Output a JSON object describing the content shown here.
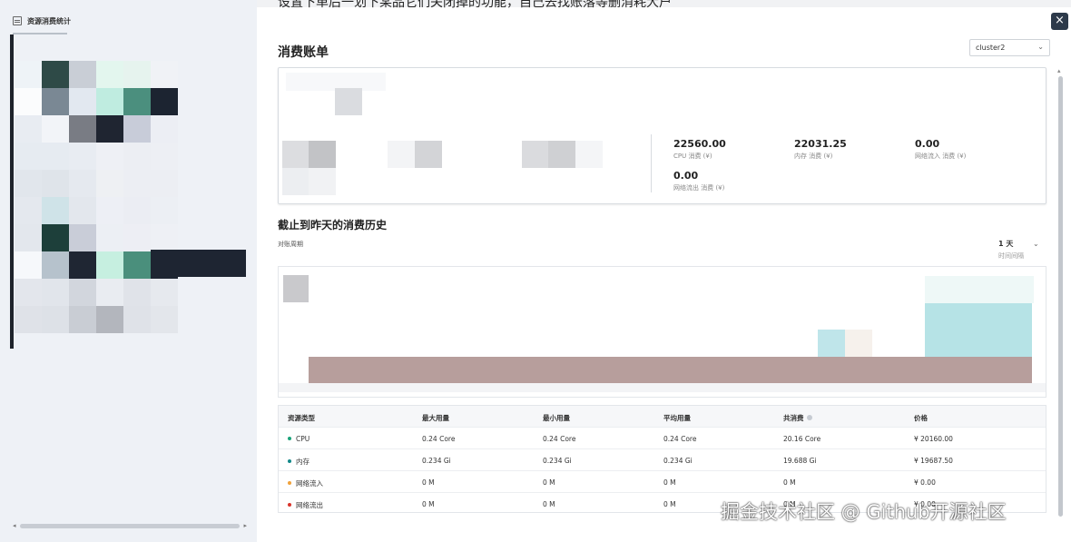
{
  "banner_text": "设置下单后一划下某品它们关闭掉的功能，自己去找账落等删消耗大户",
  "sidebar": {
    "title": "资源消费统计",
    "icon": "table-icon",
    "mosaic_tiles": [
      {
        "c": "#eef3f7"
      },
      {
        "c": "#2e4a47"
      },
      {
        "c": "#c9ced6"
      },
      {
        "c": "#e3f6ee"
      },
      {
        "c": "#e6f3ee"
      },
      {
        "c": "#f0f2f6"
      },
      {
        "c": "#fbfcfd"
      },
      {
        "c": "#7a8894"
      },
      {
        "c": "#e2e8f0"
      },
      {
        "c": "#bfece0"
      },
      {
        "c": "#4b8f7e"
      },
      {
        "c": "#1c2431"
      },
      {
        "c": "#e8ecf2"
      },
      {
        "c": "#f2f4f8"
      },
      {
        "c": "#797c84"
      },
      {
        "c": "#1f2531"
      },
      {
        "c": "#c8ccd9"
      },
      {
        "c": "#eceef4"
      },
      {
        "c": "#e6ebf1"
      },
      {
        "c": "#e6ebf1"
      },
      {
        "c": "#e8ecf2"
      },
      {
        "c": "#eef0f5"
      },
      {
        "c": "#eceef3"
      },
      {
        "c": "#edeff4"
      },
      {
        "c": "#e1e6ec"
      },
      {
        "c": "#dfe4ea"
      },
      {
        "c": "#e5e9ef"
      },
      {
        "c": "#eef0f3"
      },
      {
        "c": "#eceef3"
      },
      {
        "c": "#eceef3"
      },
      {
        "c": "#e4e8ee"
      },
      {
        "c": "#cfe3e8"
      },
      {
        "c": "#e3e7ed"
      },
      {
        "c": "#edeff5"
      },
      {
        "c": "#ebedf3"
      },
      {
        "c": "#eceff4"
      },
      {
        "c": "#e3e7ed"
      },
      {
        "c": "#1d3f3a"
      },
      {
        "c": "#c9cdd8"
      },
      {
        "c": "#eceff4"
      },
      {
        "c": "#edeef4"
      },
      {
        "c": "#eef0f5"
      },
      {
        "c": "#f6f8fb"
      },
      {
        "c": "#b6c2cc"
      },
      {
        "c": "#1f2633"
      },
      {
        "c": "#c6efe0"
      },
      {
        "c": "#4a8f7c"
      },
      {
        "c": "#1e2532"
      },
      {
        "c": "#e3e6ec"
      },
      {
        "c": "#e1e5eb"
      },
      {
        "c": "#d2d6dd"
      },
      {
        "c": "#e9ecf1"
      },
      {
        "c": "#e0e3e9"
      },
      {
        "c": "#e6e9ee"
      },
      {
        "c": "#dfe2e8"
      },
      {
        "c": "#dde1e7"
      },
      {
        "c": "#c9cdd4"
      },
      {
        "c": "#b3b6bd"
      },
      {
        "c": "#dfe2e8"
      },
      {
        "c": "#e3e6eb"
      }
    ]
  },
  "close_label": "×",
  "header": {
    "title": "消费账单",
    "cluster": "cluster2"
  },
  "summary": {
    "metrics": [
      {
        "value": "22560.00",
        "label": "CPU 消费 (¥)"
      },
      {
        "value": "22031.25",
        "label": "内存 消费 (¥)"
      },
      {
        "value": "0.00",
        "label": "网络流入 消费 (¥)"
      },
      {
        "value": "0.00",
        "label": "网络流出 消费 (¥)"
      }
    ]
  },
  "history": {
    "title": "截止到昨天的消费历史",
    "subtitle": "对账周期",
    "granularity": "1 天",
    "granularity_label": "时间间隔"
  },
  "table": {
    "headers": [
      "资源类型",
      "最大用量",
      "最小用量",
      "平均用量",
      "共消费",
      "价格"
    ],
    "rows": [
      {
        "type": "CPU",
        "dot": "#1aa37a",
        "max": "0.24 Core",
        "min": "0.24 Core",
        "avg": "0.24 Core",
        "total": "20.16 Core",
        "price": "¥ 20160.00"
      },
      {
        "type": "内存",
        "dot": "#13898a",
        "max": "0.234 Gi",
        "min": "0.234 Gi",
        "avg": "0.234 Gi",
        "total": "19.688 Gi",
        "price": "¥ 19687.50"
      },
      {
        "type": "网络流入",
        "dot": "#f0a23a",
        "max": "0 M",
        "min": "0 M",
        "avg": "0 M",
        "total": "0 M",
        "price": "¥ 0.00"
      },
      {
        "type": "网络流出",
        "dot": "#d9342b",
        "max": "0 M",
        "min": "0 M",
        "avg": "0 M",
        "total": "0 M",
        "price": "¥ 0.00"
      }
    ]
  },
  "watermark": "掘金技术社区 @ Github开源社区"
}
